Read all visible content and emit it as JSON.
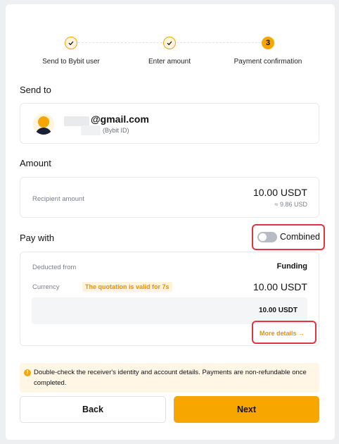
{
  "stepper": {
    "steps": [
      {
        "label": "Send to Bybit user",
        "state": "done"
      },
      {
        "label": "Enter amount",
        "state": "done"
      },
      {
        "label": "Payment confirmation",
        "state": "current",
        "number": "3"
      }
    ]
  },
  "send_to": {
    "title": "Send to",
    "email": "@gmail.com",
    "bybit_id": "(Bybit ID)"
  },
  "amount": {
    "title": "Amount",
    "recipient_label": "Recipient amount",
    "recipient_value": "10.00 USDT",
    "approx_value": "≈ 9.86 USD"
  },
  "pay_with": {
    "title": "Pay with",
    "toggle_label": "Combined",
    "toggle_on": false,
    "deducted_label": "Deducted from",
    "deducted_value": "Funding",
    "currency_label": "Currency",
    "quotation_badge": "The quotation is valid for 7s",
    "currency_value": "10.00 USDT",
    "breakdown_value": "10.00 USDT",
    "more_details": "More details →"
  },
  "notice": {
    "icon": "!",
    "text": "Double-check the receiver's identity and account details. Payments are non-refundable once completed."
  },
  "buttons": {
    "back": "Back",
    "next": "Next"
  },
  "colors": {
    "accent": "#f7a600",
    "highlight": "#e0353e"
  }
}
